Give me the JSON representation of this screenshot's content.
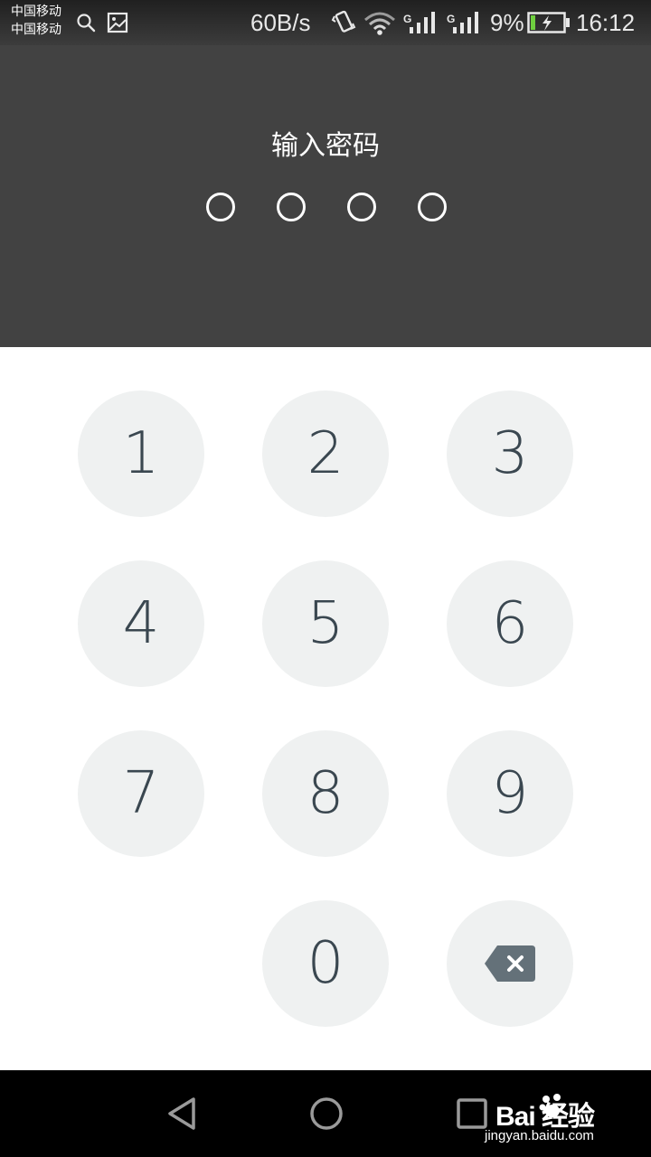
{
  "status_bar": {
    "carrier_1": "中国移动",
    "carrier_2": "中国移动",
    "net_speed": "60B/s",
    "signal_1_type": "G",
    "signal_2_type": "G",
    "battery_percent": "9%",
    "time": "16:12",
    "icons": [
      "search-icon",
      "image-icon",
      "vibrate-icon",
      "wifi-icon",
      "signal-icon",
      "signal-icon",
      "battery-charging-icon"
    ]
  },
  "pin": {
    "title": "输入密码",
    "dot_count": 4,
    "entered": 0,
    "bg_color": "#424242"
  },
  "keypad": {
    "keys": [
      "1",
      "2",
      "3",
      "4",
      "5",
      "6",
      "7",
      "8",
      "9",
      "0"
    ],
    "delete_icon": "backspace-icon",
    "key_color": "#eff1f1",
    "digit_color": "#3a4750"
  },
  "nav_bar": {
    "icons": [
      "back-icon",
      "home-icon",
      "recents-icon"
    ]
  },
  "watermark": {
    "logo": "Bai 经验",
    "url": "jingyan.baidu.com"
  }
}
